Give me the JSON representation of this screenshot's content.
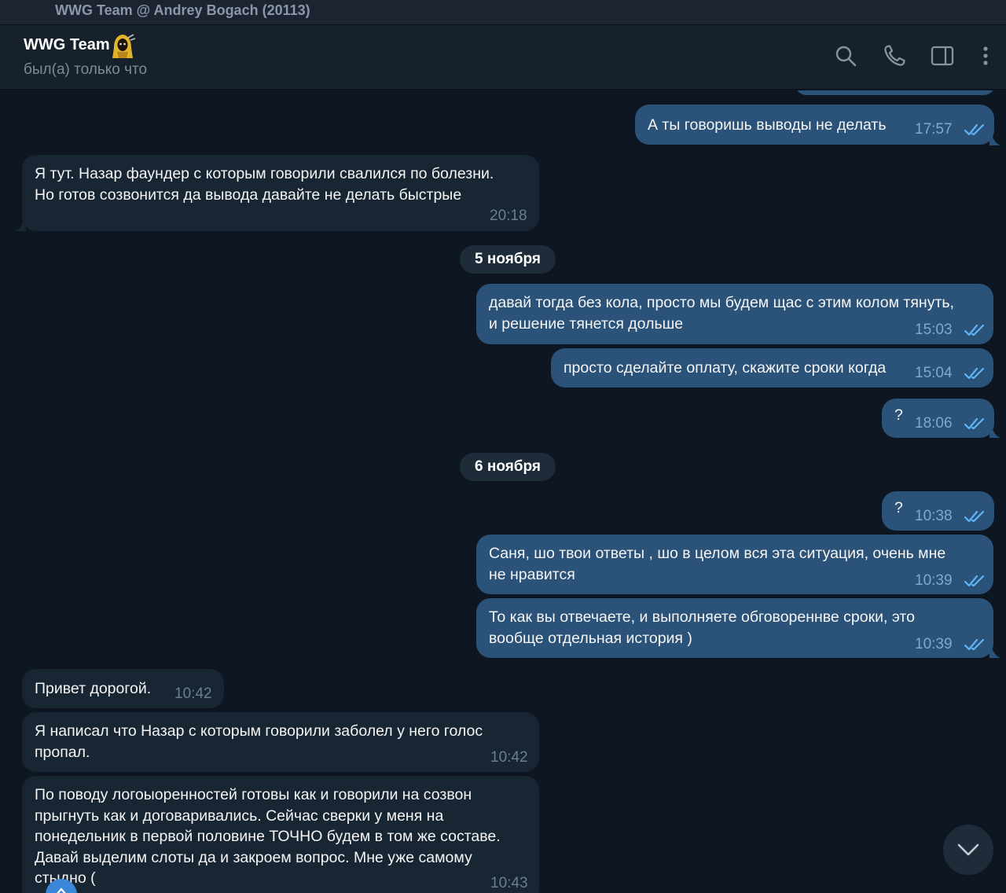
{
  "window": {
    "title": "WWG Team @ Andrey Bogach (20113)"
  },
  "header": {
    "name": "WWG Team",
    "status": "был(а) только что",
    "icons": [
      "search-icon",
      "phone-icon",
      "sidebar-toggle-icon",
      "more-vertical-icon"
    ]
  },
  "colors": {
    "background": "#0e1621",
    "header": "#17212b",
    "outgoing_bubble": "#2b5278",
    "incoming_bubble": "#182533",
    "read_check": "#5fb5f5"
  },
  "messages": [
    {
      "dir": "out",
      "text": "А ты говоришь выводы не делать",
      "time": "17:57",
      "read": true
    },
    {
      "dir": "in",
      "text": "Я тут. Назар фаундер с которым говорили свалился по болезни.\nНо готов созвонится да вывода давайте не делать быстрые",
      "time": "20:18"
    },
    {
      "dir": "out",
      "text": "давай тогда без кола, просто мы будем щас с этим колом тянуть,\nи решение тянется дольше",
      "time": "15:03",
      "read": true
    },
    {
      "dir": "out",
      "text": "просто сделайте оплату, скажите сроки когда",
      "time": "15:04",
      "read": true
    },
    {
      "dir": "out",
      "text": "?",
      "time": "18:06",
      "read": true
    },
    {
      "dir": "out",
      "text": "?",
      "time": "10:38",
      "read": true
    },
    {
      "dir": "out",
      "text": "Саня, шо твои ответы , шо в целом вся эта ситуация, очень мне\nне нравится",
      "time": "10:39",
      "read": true
    },
    {
      "dir": "out",
      "text": "То как вы отвечаете, и выполняете обговореннве сроки, это\nвообще отдельная история )",
      "time": "10:39",
      "read": true
    },
    {
      "dir": "in",
      "text": "Привет дорогой.",
      "time": "10:42"
    },
    {
      "dir": "in",
      "text": "Я написал что Назар с которым говорили заболел у него голос\nпропал.",
      "time": "10:42"
    },
    {
      "dir": "in",
      "text": "По поводу логоыоренностей готовы как и говорили на созвон\nпрыгнуть как и договаривались. Сейчас сверки у меня на\nпонедельник в первой половине ТОЧНО будем в том же составе.\nДавай выделим слоты да и закроем вопрос. Мне уже самому\nстыдно (",
      "time": "10:43"
    }
  ],
  "date_separators": [
    "5 ноября",
    "6 ноября"
  ],
  "scroll_down_icon": "chevron-down-icon"
}
